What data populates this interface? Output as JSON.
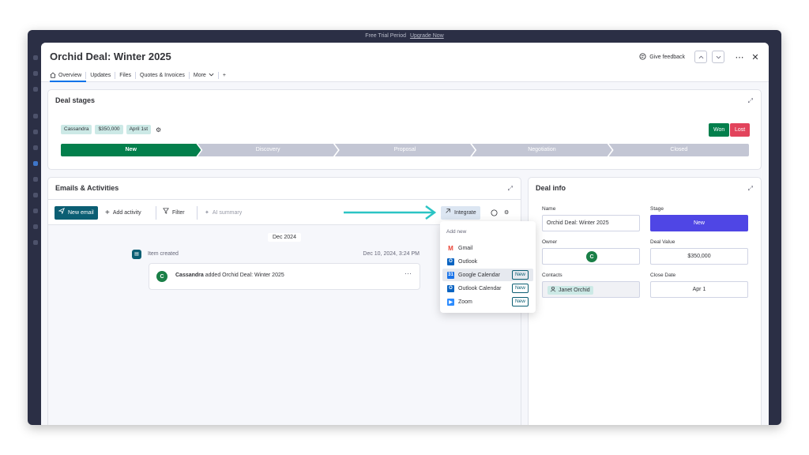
{
  "top_bar": {
    "trial_text": "Free Trial Period",
    "upgrade_link": "Upgrade Now"
  },
  "modal": {
    "title": "Orchid Deal: Winter 2025",
    "tabs": [
      {
        "label": "Overview",
        "icon": "home-icon",
        "active": true
      },
      {
        "label": "Updates"
      },
      {
        "label": "Files"
      },
      {
        "label": "Quotes & Invoices"
      },
      {
        "label": "More",
        "icon": "chevron-down-icon"
      },
      {
        "label": "+"
      }
    ],
    "feedback_label": "Give feedback"
  },
  "deal_stages": {
    "title": "Deal stages",
    "tags": [
      "Cassandra",
      "$350,000",
      "April 1st"
    ],
    "steps": [
      "New",
      "Discovery",
      "Proposal",
      "Negotiation",
      "Closed"
    ],
    "active_step": "New",
    "won_label": "Won",
    "lost_label": "Lost"
  },
  "emails": {
    "title": "Emails & Activities",
    "new_email": "New email",
    "add_activity": "Add activity",
    "filter": "Filter",
    "ai_summary": "AI summary",
    "integrate": "Integrate",
    "date_group": "Dec 2024",
    "item_created": "Item created",
    "item_date": "Dec 10, 2024, 3:24 PM",
    "activity_user": "Cassandra",
    "activity_text": "added Orchid Deal: Winter 2025",
    "avatar_letter": "C"
  },
  "integrate_menu": {
    "header": "Add new",
    "items": [
      {
        "label": "Gmail",
        "icon": "gmail-icon",
        "color": "#ea4335"
      },
      {
        "label": "Outlook",
        "icon": "outlook-icon",
        "color": "#0a64c2"
      },
      {
        "label": "Google Calendar",
        "icon": "google-calendar-icon",
        "color": "#1a73e8",
        "badge": "New"
      },
      {
        "label": "Outlook Calendar",
        "icon": "outlook-calendar-icon",
        "color": "#0a64c2",
        "badge": "New"
      },
      {
        "label": "Zoom",
        "icon": "zoom-icon",
        "color": "#2d8cff",
        "badge": "New"
      }
    ]
  },
  "deal_info": {
    "title": "Deal info",
    "name_label": "Name",
    "name_value": "Orchid Deal: Winter 2025",
    "stage_label": "Stage",
    "stage_value": "New",
    "owner_label": "Owner",
    "owner_avatar": "C",
    "deal_value_label": "Deal Value",
    "deal_value": "$350,000",
    "contacts_label": "Contacts",
    "contact_value": "Janet Orchid",
    "close_date_label": "Close Date",
    "close_date_value": "Apr 1"
  },
  "colors": {
    "accent_teal": "#0b5e73",
    "won": "#037f4c",
    "lost": "#e2445c",
    "stage_new": "#4f46e5",
    "arrow": "#2bc4c4"
  }
}
